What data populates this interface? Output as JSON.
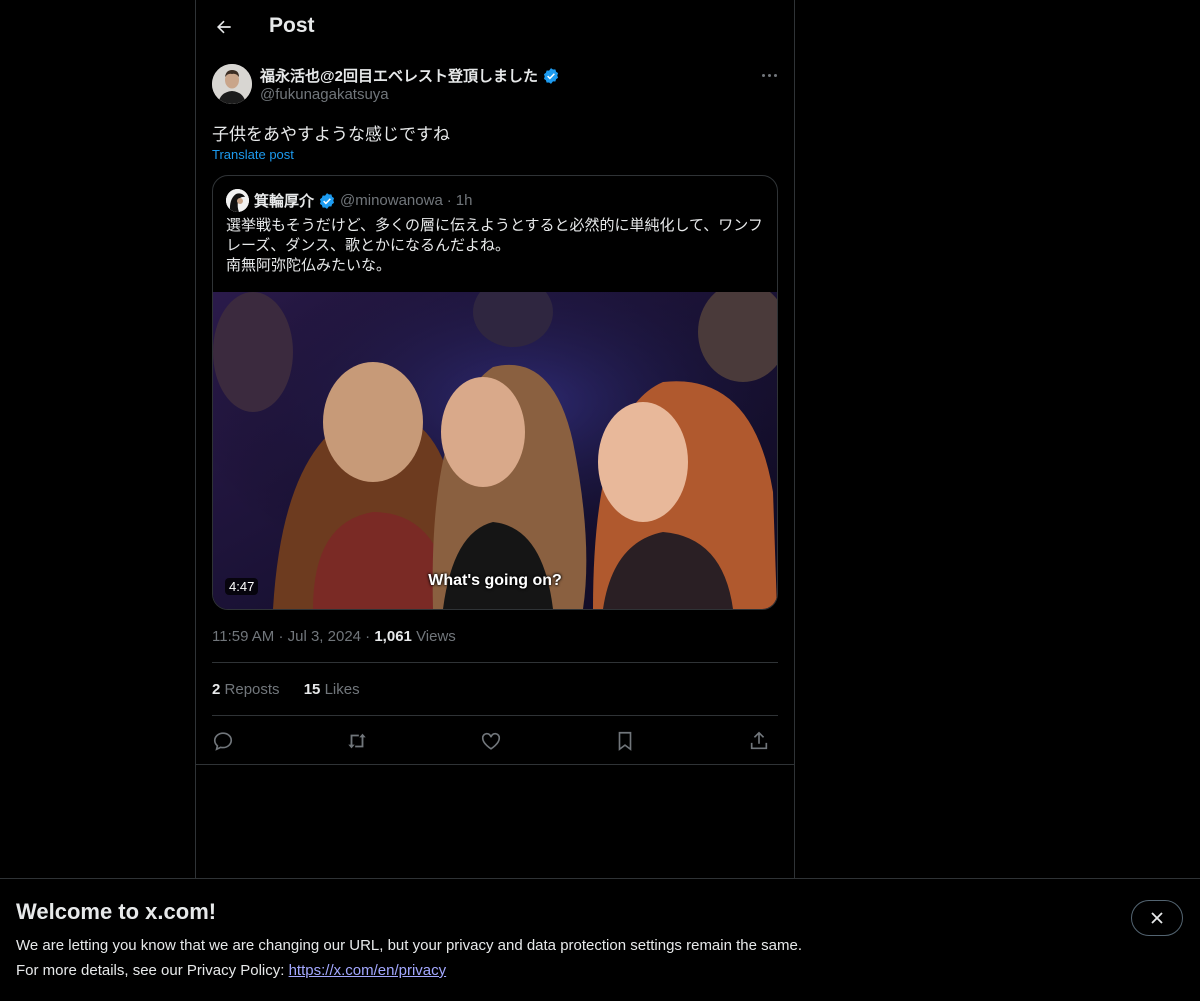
{
  "header": {
    "title": "Post"
  },
  "post": {
    "author_name": "福永活也@2回目エベレスト登頂しました",
    "author_handle": "@fukunagakatsuya",
    "text": "子供をあやすような感じですね",
    "translate_label": "Translate post",
    "quote": {
      "author_name": "箕輪厚介",
      "author_handle": "@minowanowa",
      "separator": "·",
      "time": "1h",
      "text_lines": [
        "選挙戦もそうだけど、多くの層に伝えようとすると必然的に単純化して、ワンフ",
        "レーズ、ダンス、歌とかになるんだよね。",
        "南無阿弥陀仏みたいな。"
      ],
      "video": {
        "duration": "4:47",
        "caption": "What's going on?"
      }
    },
    "meta": {
      "time": "11:59 AM",
      "date": "Jul 3, 2024",
      "views_count": "1,061",
      "views_label": "Views",
      "separator": "·"
    },
    "stats": {
      "reposts_count": "2",
      "reposts_label": "Reposts",
      "likes_count": "15",
      "likes_label": "Likes"
    }
  },
  "banner": {
    "title": "Welcome to x.com!",
    "line1": "We are letting you know that we are changing our URL, but your privacy and data protection settings remain the same.",
    "line2_prefix": "For more details, see our Privacy Policy: ",
    "link": "https://x.com/en/privacy"
  },
  "colors": {
    "background": "#000000",
    "text": "#e7e9ea",
    "secondary": "#71767b",
    "accent": "#1d9bf0",
    "border": "#2f3336",
    "link": "#a3a8ff"
  },
  "icons": [
    "back-arrow-icon",
    "verified-badge-icon",
    "more-icon",
    "reply-icon",
    "repost-icon",
    "like-icon",
    "bookmark-icon",
    "share-icon",
    "close-icon"
  ]
}
